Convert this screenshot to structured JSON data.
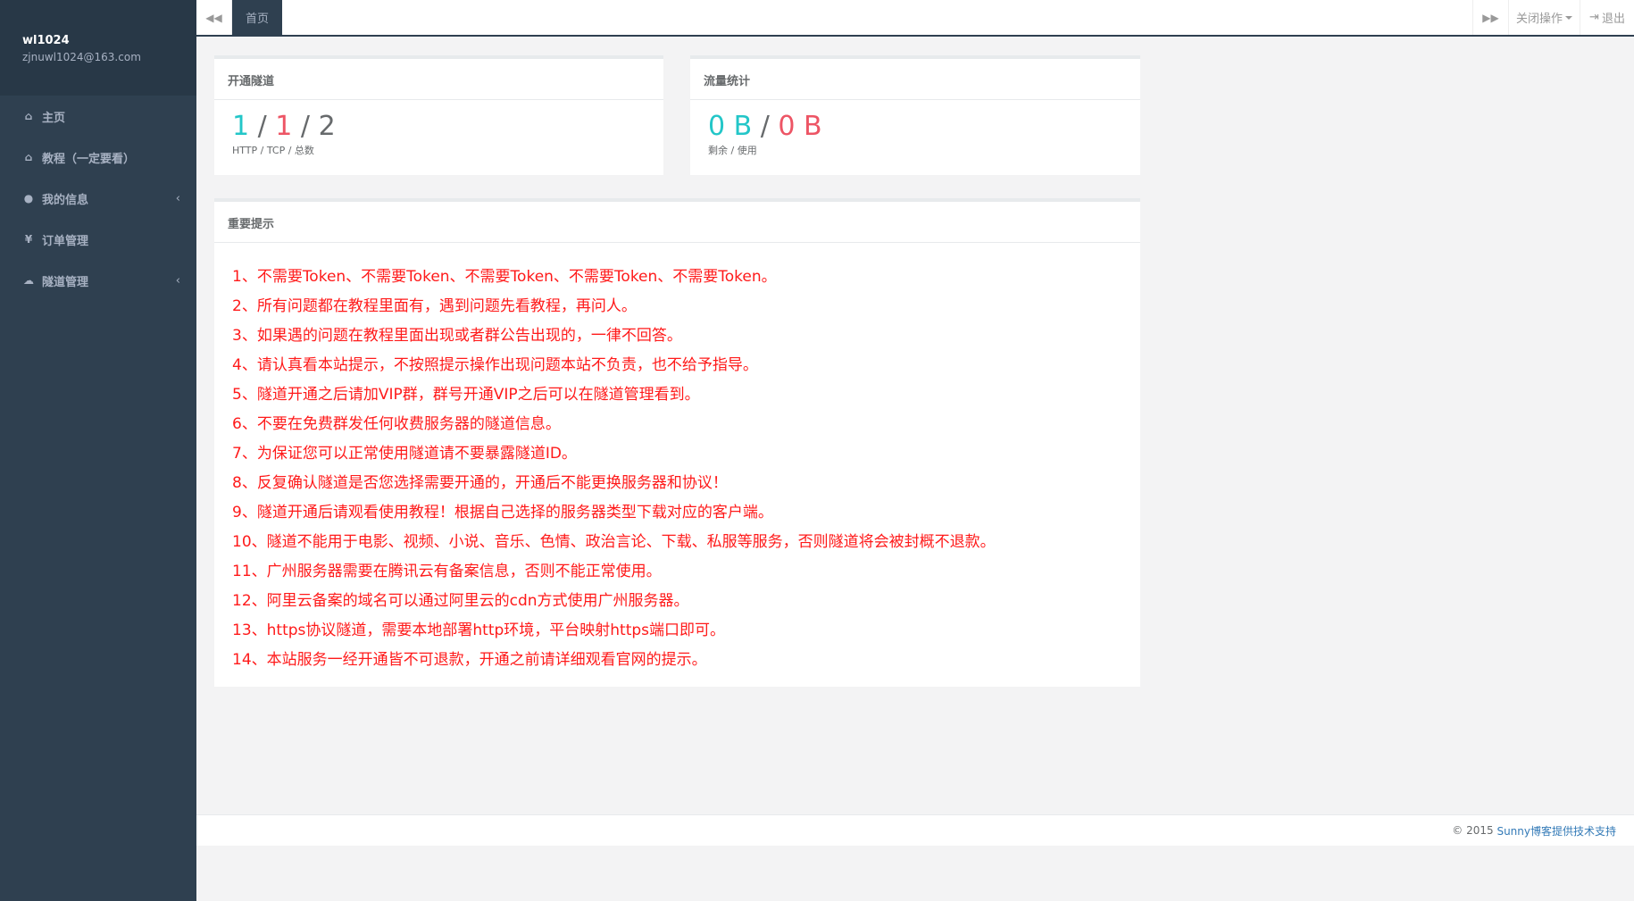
{
  "profile": {
    "username": "wl1024",
    "email": "zjnuwl1024@163.com"
  },
  "sidebar": {
    "items": [
      {
        "icon": "home-icon",
        "glyph": "⌂",
        "label": "主页",
        "has_arrow": false
      },
      {
        "icon": "home-icon",
        "glyph": "⌂",
        "label": "教程（一定要看）",
        "has_arrow": false
      },
      {
        "icon": "user-icon",
        "glyph": "●",
        "label": "我的信息",
        "has_arrow": true
      },
      {
        "icon": "yen-icon",
        "glyph": "¥",
        "label": "订单管理",
        "has_arrow": false
      },
      {
        "icon": "cloud-icon",
        "glyph": "☁",
        "label": "隧道管理",
        "has_arrow": true
      }
    ],
    "arrow_glyph": "‹"
  },
  "topbar": {
    "left_arrow": "◀◀",
    "tab_home": "首页",
    "right_arrow": "▶▶",
    "close_ops": "关闭操作",
    "logout_icon": "⇥",
    "logout": "退出"
  },
  "tunnel_panel": {
    "title": "开通隧道",
    "http": "1",
    "sep1": " / ",
    "tcp": "1",
    "sep2": " / ",
    "total": "2",
    "caption": "HTTP / TCP / 总数"
  },
  "traffic_panel": {
    "title": "流量统计",
    "remaining": "0 B",
    "sep": " / ",
    "used": "0 B",
    "caption": "剩余 / 使用"
  },
  "notice_panel": {
    "title": "重要提示",
    "items": [
      "1、不需要Token、不需要Token、不需要Token、不需要Token、不需要Token。",
      "2、所有问题都在教程里面有，遇到问题先看教程，再问人。",
      "3、如果遇的问题在教程里面出现或者群公告出现的，一律不回答。",
      "4、请认真看本站提示，不按照提示操作出现问题本站不负责，也不给予指导。",
      "5、隧道开通之后请加VIP群，群号开通VIP之后可以在隧道管理看到。",
      "6、不要在免费群发任何收费服务器的隧道信息。",
      "7、为保证您可以正常使用隧道请不要暴露隧道ID。",
      "8、反复确认隧道是否您选择需要开通的，开通后不能更换服务器和协议！",
      "9、隧道开通后请观看使用教程！根据自己选择的服务器类型下载对应的客户端。",
      "10、隧道不能用于电影、视频、小说、音乐、色情、政治言论、下载、私服等服务，否则隧道将会被封概不退款。",
      "11、广州服务器需要在腾讯云有备案信息，否则不能正常使用。",
      "12、阿里云备案的域名可以通过阿里云的cdn方式使用广州服务器。",
      "13、https协议隧道，需要本地部署http环境，平台映射https端口即可。",
      "14、本站服务一经开通皆不可退款，开通之前请详细观看官网的提示。"
    ]
  },
  "footer": {
    "prefix": "© 2015 ",
    "link": "Sunny博客提供技术支持"
  },
  "colors": {
    "sidebar_bg": "#2f4050",
    "cyan": "#23c6c8",
    "red": "#ed5565",
    "notice_red": "#ff1a1a"
  }
}
